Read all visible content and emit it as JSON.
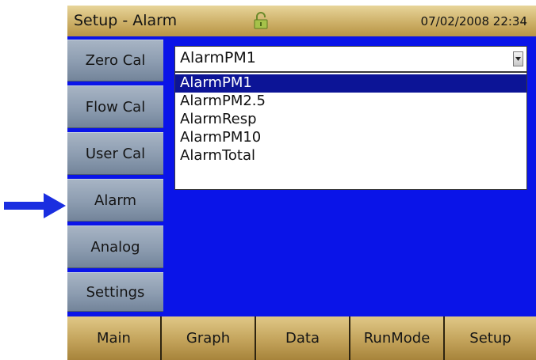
{
  "header": {
    "title": "Setup - Alarm",
    "datetime": "07/02/2008 22:34",
    "lock_icon": "padlock-icon"
  },
  "sidebar": {
    "items": [
      {
        "label": "Zero Cal"
      },
      {
        "label": "Flow Cal"
      },
      {
        "label": "User Cal"
      },
      {
        "label": "Alarm"
      },
      {
        "label": "Analog"
      },
      {
        "label": "Settings"
      }
    ]
  },
  "alarm_select": {
    "value": "AlarmPM1",
    "options": [
      "AlarmPM1",
      "AlarmPM2.5",
      "AlarmResp",
      "AlarmPM10",
      "AlarmTotal"
    ],
    "highlighted": "AlarmPM1"
  },
  "bottom_tabs": [
    {
      "label": "Main"
    },
    {
      "label": "Graph"
    },
    {
      "label": "Data"
    },
    {
      "label": "RunMode"
    },
    {
      "label": "Setup"
    }
  ],
  "colors": {
    "screen_background": "#0a14e8",
    "highlight": "#0c1496",
    "callout_arrow": "#1a2ee0"
  },
  "callout": {
    "icon": "right-arrow-icon",
    "points_to": "Alarm"
  }
}
